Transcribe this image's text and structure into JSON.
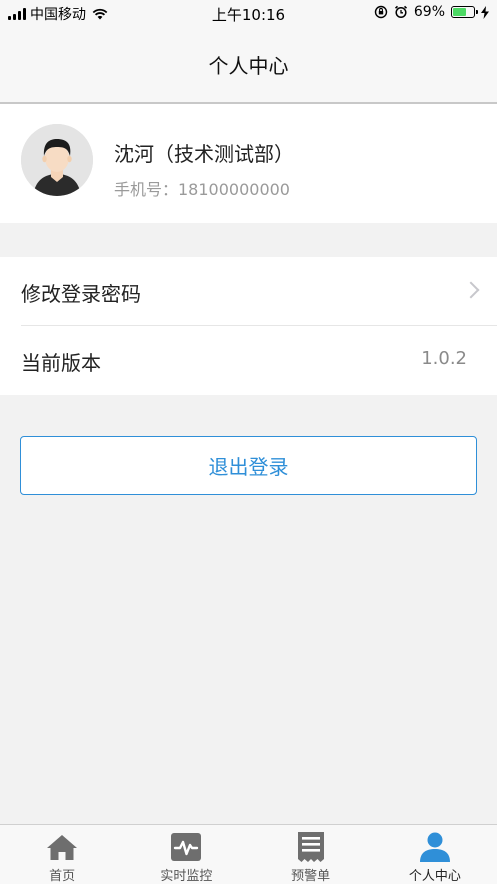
{
  "status_bar": {
    "carrier": "中国移动",
    "time": "上午10:16",
    "battery": "69%",
    "battery_level": 0.69
  },
  "nav": {
    "title": "个人中心"
  },
  "profile": {
    "name": "沈河（技术测试部）",
    "phone": "手机号：18100000000"
  },
  "menu": {
    "items": [
      {
        "label": "修改登录密码",
        "value": ""
      },
      {
        "label": "当前版本",
        "value": "1.0.2"
      }
    ]
  },
  "actions": {
    "logout_label": "退出登录"
  },
  "tab_bar": {
    "tabs": [
      {
        "label": "首页",
        "icon": "home-icon"
      },
      {
        "label": "实时监控",
        "icon": "monitor-icon"
      },
      {
        "label": "预警单",
        "icon": "list-icon"
      },
      {
        "label": "个人中心",
        "icon": "user-icon"
      }
    ],
    "active_index": 3
  },
  "colors": {
    "accent": "#2f8fd8",
    "tab_inactive": "#6e6e6e",
    "battery": "#4cd964"
  }
}
